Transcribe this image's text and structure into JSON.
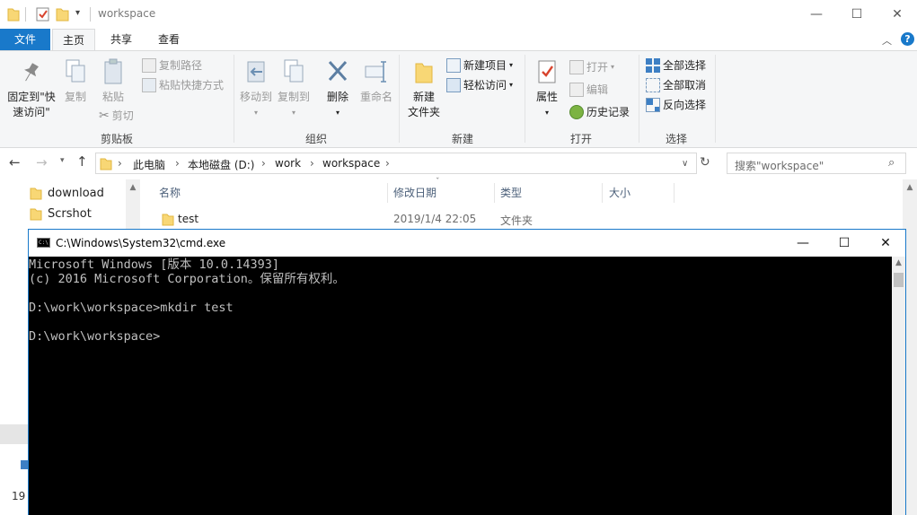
{
  "explorer": {
    "title": "workspace",
    "tabs": {
      "file": "文件",
      "home": "主页",
      "share": "共享",
      "view": "查看"
    },
    "ribbon": {
      "clipboard": {
        "label": "剪贴板",
        "pin_line1": "固定到\"快",
        "pin_line2": "速访问\"",
        "copy": "复制",
        "paste": "粘贴",
        "copy_path": "复制路径",
        "paste_shortcut": "粘贴快捷方式",
        "cut": "剪切"
      },
      "organize": {
        "label": "组织",
        "move_to": "移动到",
        "copy_to": "复制到",
        "delete": "删除",
        "rename": "重命名"
      },
      "new": {
        "label": "新建",
        "new_folder_line1": "新建",
        "new_folder_line2": "文件夹",
        "new_item": "新建项目",
        "easy_access": "轻松访问"
      },
      "open": {
        "label": "打开",
        "properties": "属性",
        "open": "打开",
        "edit": "编辑",
        "history": "历史记录"
      },
      "select": {
        "label": "选择",
        "select_all": "全部选择",
        "select_none": "全部取消",
        "invert": "反向选择"
      }
    },
    "address": {
      "crumbs": [
        "此电脑",
        "本地磁盘 (D:)",
        "work",
        "workspace"
      ]
    },
    "search_placeholder": "搜索\"workspace\"",
    "nav_items": [
      "download",
      "Scrshot"
    ],
    "columns": {
      "name": "名称",
      "modified": "修改日期",
      "type": "类型",
      "size": "大小"
    },
    "files": [
      {
        "name": "test",
        "modified": "2019/1/4 22:05",
        "type": "文件夹"
      }
    ],
    "status_partial": "19"
  },
  "cmd": {
    "title": "C:\\Windows\\System32\\cmd.exe",
    "lines": [
      "Microsoft Windows [版本 10.0.14393]",
      "(c) 2016 Microsoft Corporation。保留所有权利。",
      "",
      "D:\\work\\workspace>mkdir test",
      "",
      "D:\\work\\workspace>"
    ]
  },
  "colors": {
    "accent": "#1979ca",
    "ribbon_bg": "#f5f6f7",
    "console_bg": "#000000",
    "console_fg": "#c0c0c0",
    "folder": "#f8d775"
  }
}
